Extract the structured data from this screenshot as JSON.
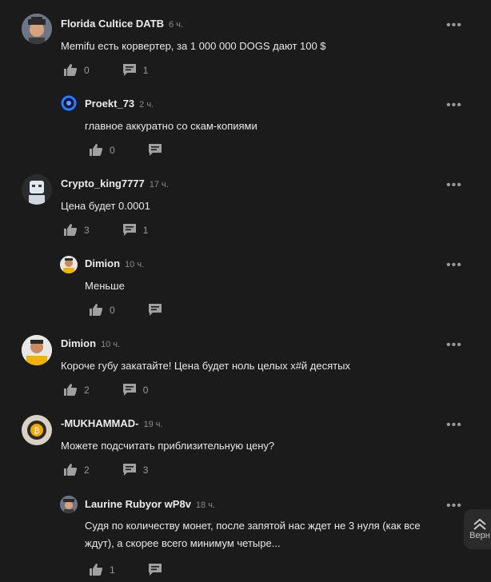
{
  "comments": [
    {
      "author": "Florida Cultice DATB",
      "time": "6 ч.",
      "text": "Memifu есть корвертер, за 1 000 000 DOGS дают 100 $",
      "likes": "0",
      "replies": "1"
    },
    {
      "author": "Proekt_73",
      "time": "2 ч.",
      "text": "главное аккуратно со скам-копиями",
      "likes": "0",
      "replies": ""
    },
    {
      "author": "Crypto_king7777",
      "time": "17 ч.",
      "text": "Цена будет 0.0001",
      "likes": "3",
      "replies": "1"
    },
    {
      "author": "Dimion",
      "time": "10 ч.",
      "text": "Меньше",
      "likes": "0",
      "replies": ""
    },
    {
      "author": "Dimion",
      "time": "10 ч.",
      "text": "Короче губу закатайте! Цена будет ноль целых х#й десятых",
      "likes": "2",
      "replies": "0"
    },
    {
      "author": "-MUKHAMMAD-",
      "time": "19 ч.",
      "text": "Можете подсчитать приблизительную цену?",
      "likes": "2",
      "replies": "3"
    },
    {
      "author": "Laurine Rubyor wP8v",
      "time": "18 ч.",
      "text": "Судя по количеству монет, после запятой нас ждет не 3 нуля (как все ждут), а скорее всего минимум четыре...",
      "likes": "1",
      "replies": ""
    }
  ],
  "more_label": "•••",
  "scroll_button": {
    "label": "Верн"
  },
  "colors": {
    "background": "#1b1b1b",
    "text": "#e6e6e6",
    "muted": "#9a9a9a"
  }
}
